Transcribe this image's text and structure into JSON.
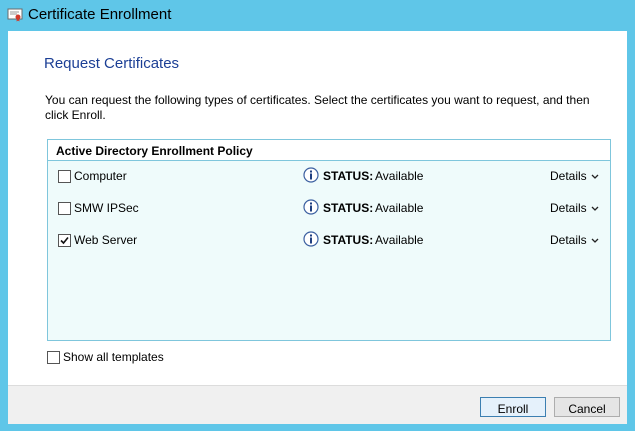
{
  "window": {
    "title": "Certificate Enrollment"
  },
  "page": {
    "heading": "Request Certificates",
    "intro": "You can request the following types of certificates. Select the certificates you want to request, and then click Enroll."
  },
  "policy": {
    "title": "Active Directory Enrollment Policy",
    "items": [
      {
        "name": "Computer",
        "checked": false,
        "status_label": "STATUS:",
        "status": "Available",
        "details": "Details"
      },
      {
        "name": "SMW IPSec",
        "checked": false,
        "status_label": "STATUS:",
        "status": "Available",
        "details": "Details"
      },
      {
        "name": "Web Server",
        "checked": true,
        "status_label": "STATUS:",
        "status": "Available",
        "details": "Details"
      }
    ]
  },
  "show_all": {
    "label": "Show all templates",
    "checked": false
  },
  "buttons": {
    "enroll": "Enroll",
    "cancel": "Cancel"
  },
  "colors": {
    "titlebar": "#5fc6e8",
    "heading": "#1c3f95",
    "policy_bg": "#effbfb",
    "policy_border": "#7fc6dc"
  }
}
